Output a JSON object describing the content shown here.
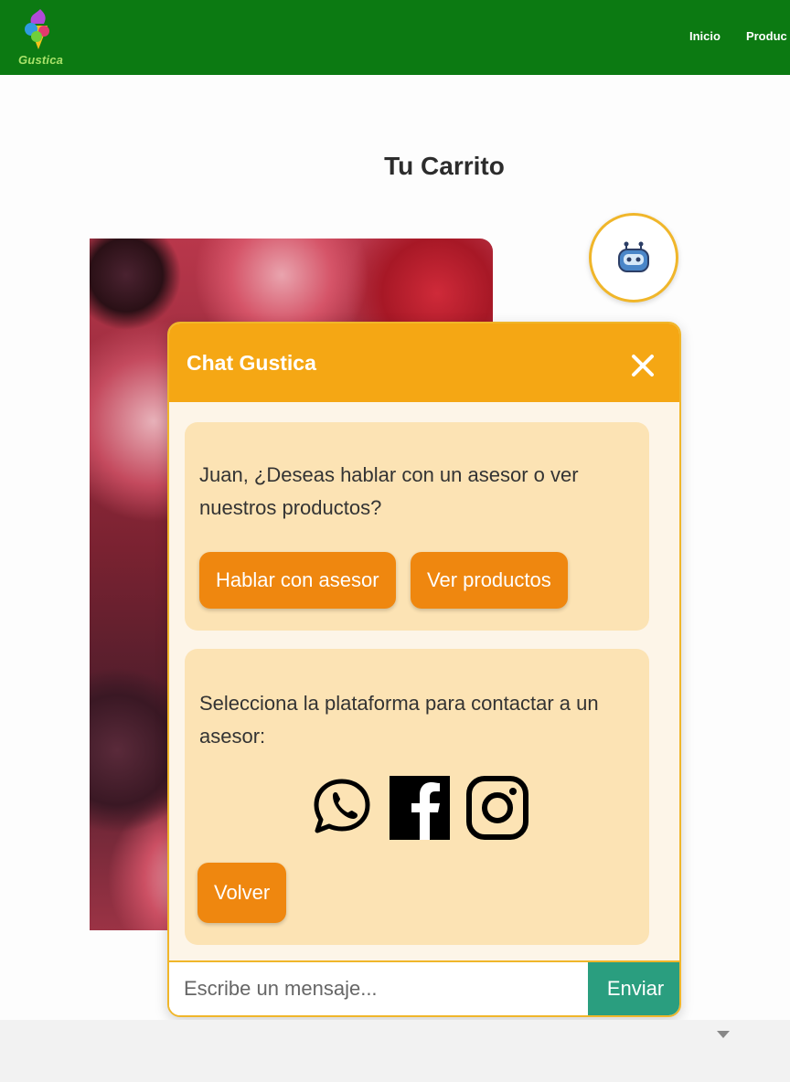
{
  "navbar": {
    "brand": "Gustica",
    "links": [
      "Inicio",
      "Produc"
    ]
  },
  "page": {
    "title": "Tu Carrito"
  },
  "chat": {
    "title": "Chat Gustica",
    "message_1": "Juan, ¿Deseas hablar con un asesor o ver nuestros productos?",
    "option_advisor": "Hablar con asesor",
    "option_products": "Ver productos",
    "message_2": "Selecciona la plataforma para contactar a un asesor:",
    "platforms": [
      "whatsapp-icon",
      "facebook-icon",
      "instagram-icon"
    ],
    "back_label": "Volver",
    "input_placeholder": "Escribe un mensaje...",
    "send_label": "Enviar"
  },
  "colors": {
    "navbar": "#0c7a12",
    "chat_header": "#f5a714",
    "bubble": "#fce3b4",
    "button": "#ef870f",
    "send": "#2a9e7f"
  }
}
